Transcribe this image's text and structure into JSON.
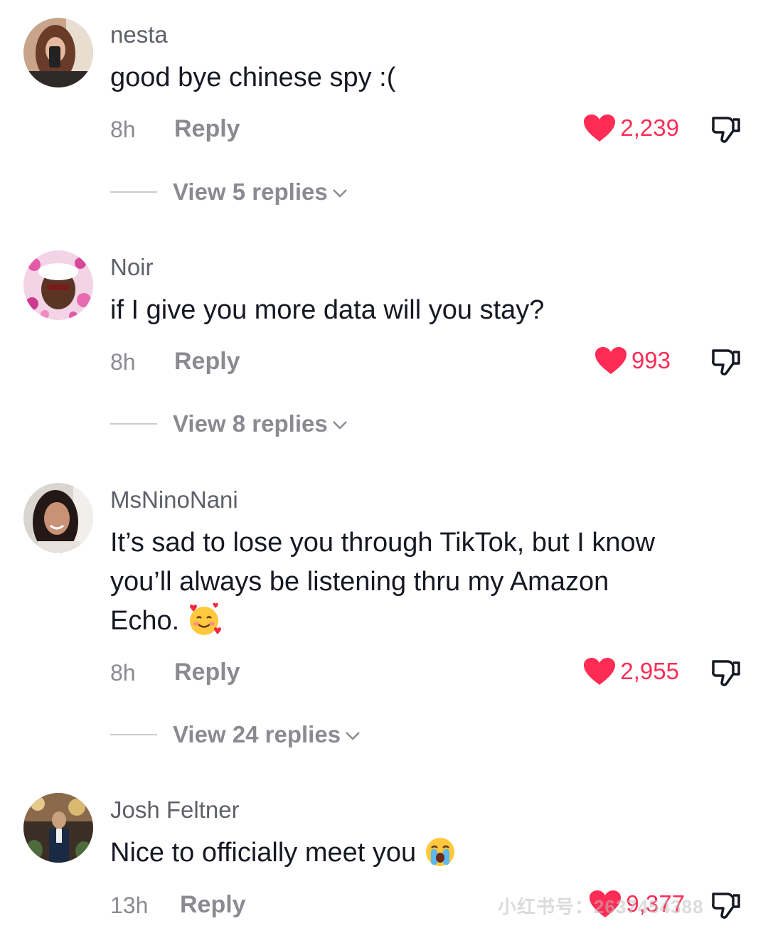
{
  "comments": [
    {
      "username": "nesta",
      "text": "good bye chinese spy :(",
      "time": "8h",
      "reply_label": "Reply",
      "likes": "2,239",
      "view_replies": "View 5 replies"
    },
    {
      "username": "Noir",
      "text": "if I give you more data will you stay?",
      "time": "8h",
      "reply_label": "Reply",
      "likes": "993",
      "view_replies": "View 8 replies"
    },
    {
      "username": "MsNinoNani",
      "text_lines": [
        "It’s sad to lose you through TikTok, but I know",
        "you’ll always be listening thru my Amazon",
        "Echo."
      ],
      "emoji": "smiling-face-with-hearts",
      "time": "8h",
      "reply_label": "Reply",
      "likes": "2,955",
      "view_replies": "View 24 replies"
    },
    {
      "username": "Josh Feltner",
      "text": "Nice to officially meet you",
      "emoji": "loudly-crying-face",
      "time": "13h",
      "reply_label": "Reply",
      "likes": "9,377"
    }
  ],
  "watermark": "小红书号：2637454388",
  "colors": {
    "like": "#fe2c55",
    "meta": "#8a8b91",
    "username": "#5e6068",
    "text": "#161823"
  }
}
